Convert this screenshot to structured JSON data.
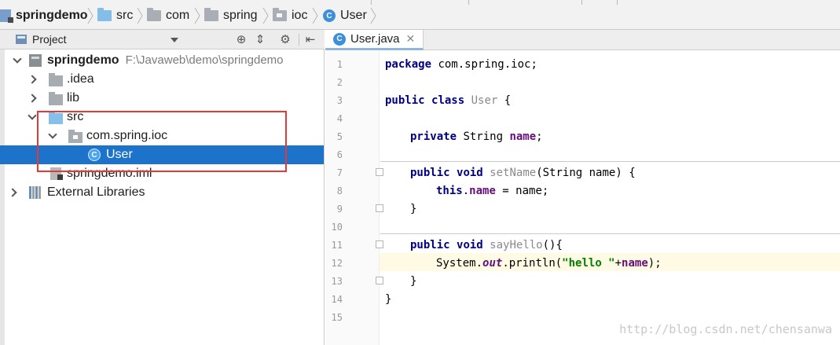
{
  "breadcrumb": [
    {
      "label": "springdemo",
      "icon": "module-icon"
    },
    {
      "label": "src",
      "icon": "folder-blue-icon"
    },
    {
      "label": "com",
      "icon": "folder-icon"
    },
    {
      "label": "spring",
      "icon": "folder-icon"
    },
    {
      "label": "ioc",
      "icon": "package-icon"
    },
    {
      "label": "User",
      "icon": "class-icon"
    }
  ],
  "project_panel": {
    "title": "Project",
    "tree": [
      {
        "label": "springdemo",
        "path": "F:\\Javaweb\\demo\\springdemo"
      },
      {
        "label": ".idea"
      },
      {
        "label": "lib"
      },
      {
        "label": "src"
      },
      {
        "label": "com.spring.ioc"
      },
      {
        "label": "User"
      },
      {
        "label": "springdemo.iml"
      },
      {
        "label": "External Libraries"
      }
    ]
  },
  "editor": {
    "tab_label": "User.java",
    "line_numbers": [
      "1",
      "2",
      "3",
      "4",
      "5",
      "6",
      "7",
      "8",
      "9",
      "10",
      "11",
      "12",
      "13",
      "14",
      "15"
    ],
    "code": {
      "l1": {
        "kw": "package",
        "rest": " com.spring.ioc;"
      },
      "l3": {
        "kw1": "public",
        "kw2": "class",
        "name": "User",
        "rest": " {"
      },
      "l5": {
        "kw": "private",
        "type": " String ",
        "field": "name",
        "rest": ";"
      },
      "l7": {
        "kw1": "public",
        "kw2": "void",
        "name": "setName",
        "rest": "(String name) {"
      },
      "l8": {
        "kw": "this",
        "dot": ".",
        "field": "name",
        "rest": " = name;"
      },
      "l9": "}",
      "l11": {
        "kw1": "public",
        "kw2": "void",
        "name": "sayHello",
        "rest": "(){"
      },
      "l12": {
        "cls": "System.",
        "sfield": "out",
        "call": ".println(",
        "str": "\"hello \"",
        "plus": "+",
        "field": "name",
        "rest": ");"
      },
      "l13": "}",
      "l14": "}"
    },
    "watermark": "http://blog.csdn.net/chensanwa"
  },
  "colors": {
    "selection": "#1d73c9",
    "highlight_box": "#e53935",
    "keyword": "#000080",
    "field": "#660e7a",
    "string": "#008000"
  }
}
